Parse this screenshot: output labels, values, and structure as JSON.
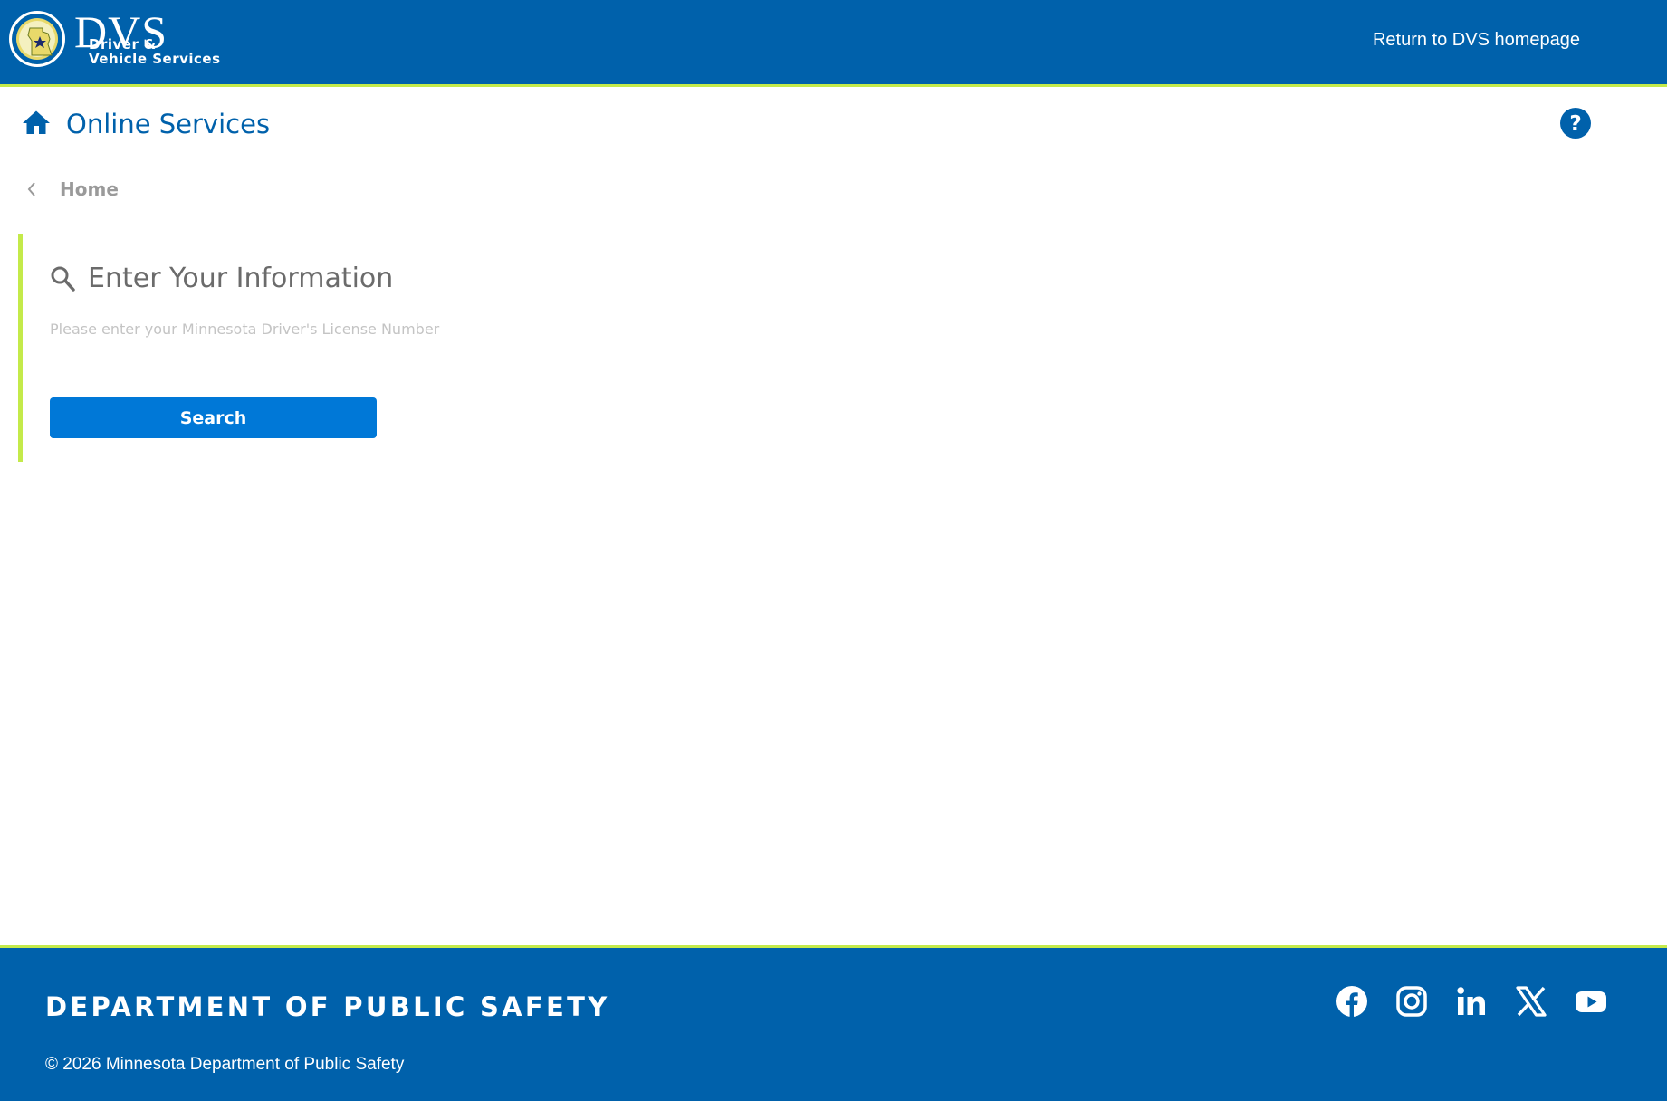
{
  "header": {
    "logo_big": "DVS",
    "logo_line1": "Driver &",
    "logo_line2": "Vehicle Services",
    "return_link": "Return to DVS homepage"
  },
  "title_bar": {
    "title": "Online Services",
    "home_icon": "home-icon",
    "help_icon": "help-icon"
  },
  "breadcrumb": {
    "label": "Home",
    "icon": "chevron-left-icon"
  },
  "form": {
    "title": "Enter Your Information",
    "title_icon": "search-icon",
    "placeholder": "Please enter your Minnesota Driver's License Number",
    "value": "",
    "button": "Search"
  },
  "footer": {
    "brand": "DEPARTMENT OF PUBLIC SAFETY",
    "copyright": "© 2026 Minnesota Department of Public Safety",
    "social": [
      "facebook-icon",
      "instagram-icon",
      "linkedin-icon",
      "x-icon",
      "youtube-icon"
    ]
  },
  "colors": {
    "primary": "#0061ab",
    "accent": "#c4ea4a",
    "button": "#0078d7"
  }
}
